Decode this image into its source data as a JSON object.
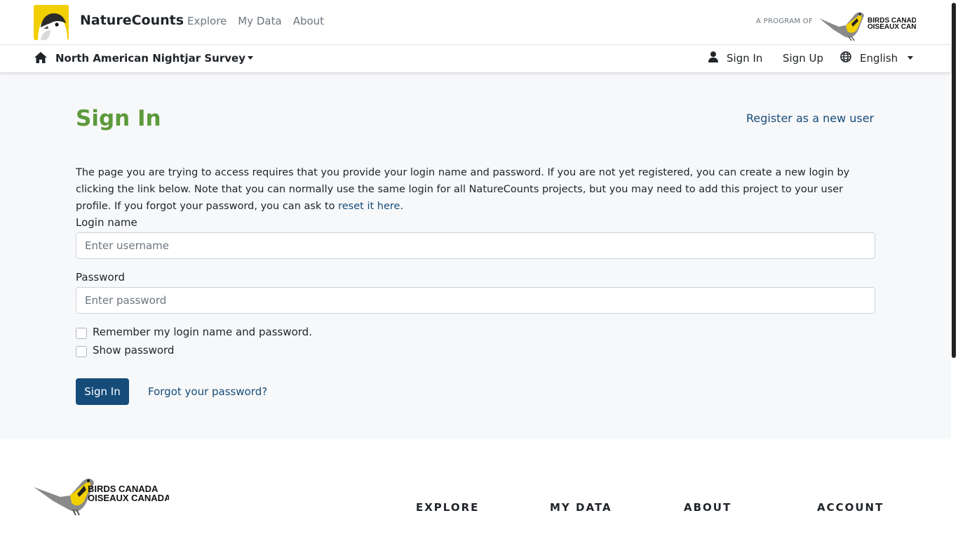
{
  "header": {
    "brand": "NatureCounts",
    "nav": [
      "Explore",
      "My Data",
      "About"
    ],
    "program_label": "A PROGRAM OF",
    "partner_logo_text": [
      "BIRDS CANADA",
      "OISEAUX CANADA"
    ]
  },
  "subnav": {
    "project": "North American Nightjar Survey",
    "sign_in": "Sign In",
    "sign_up": "Sign Up",
    "language": "English"
  },
  "page": {
    "title": "Sign In",
    "register_link": "Register as a new user",
    "intro_text": "The page you are trying to access requires that you provide your login name and password. If you are not yet registered, you can create a new login by clicking the link below. Note that you can normally use the same login for all NatureCounts projects, but you may need to add this project to your user profile. If you forgot your password, you can ask to ",
    "reset_link": "reset it here",
    "intro_end": "."
  },
  "form": {
    "login_label": "Login name",
    "login_placeholder": "Enter username",
    "login_value": "",
    "password_label": "Password",
    "password_placeholder": "Enter password",
    "password_value": "",
    "remember_label": "Remember my login name and password.",
    "remember_checked": false,
    "show_password_label": "Show password",
    "show_password_checked": false,
    "submit_label": "Sign In",
    "forgot_link": "Forgot your password?"
  },
  "footer": {
    "logo_text": [
      "BIRDS CANADA",
      "OISEAUX CANADA"
    ],
    "columns": [
      "EXPLORE",
      "MY DATA",
      "ABOUT",
      "ACCOUNT"
    ]
  },
  "colors": {
    "title_green": "#5c9a3b",
    "link_blue": "#154c7a",
    "logo_yellow": "#f2cf00",
    "page_bg": "#f7f8f9"
  },
  "icons": [
    "home-icon",
    "user-icon",
    "globe-icon",
    "chevron-down-icon",
    "nature-counts-logo",
    "birds-canada-logo"
  ]
}
